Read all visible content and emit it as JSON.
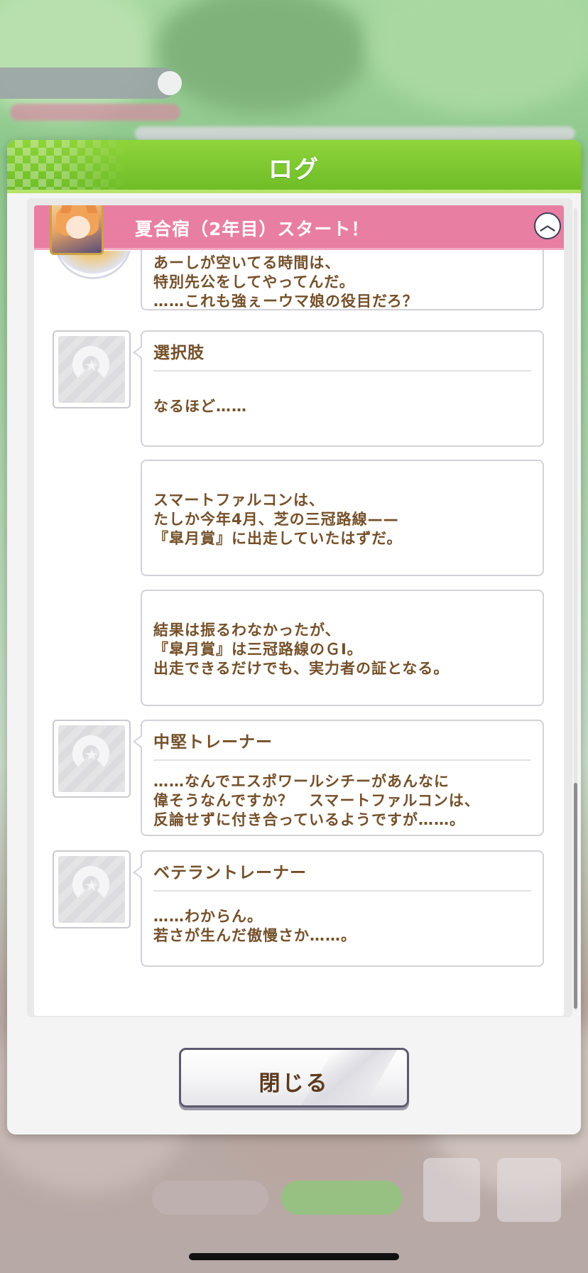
{
  "dialog": {
    "title": "ログ",
    "close_label": "閉じる"
  },
  "section": {
    "title": "夏合宿（2年目）スタート！",
    "collapse_icon": "chevron-up-icon"
  },
  "entries": [
    {
      "speaker": "",
      "text": "あーしが空いてる時間は、\n特別先公をしてやってんだ。\n……これも強ぇーウマ娘の役目だろ？"
    },
    {
      "speaker": "選択肢",
      "text": "なるほど……"
    },
    {
      "speaker": "",
      "text": "スマートファルコンは、\nたしか今年4月、芝の三冠路線——\n『皐月賞』に出走していたはずだ。"
    },
    {
      "speaker": "",
      "text": "結果は振るわなかったが、\n『皐月賞』は三冠路線のＧⅠ。\n出走できるだけでも、実力者の証となる。"
    },
    {
      "speaker": "中堅トレーナー",
      "text": "……なんでエスポワールシチーがあんなに\n偉そうなんですか？　スマートファルコンは、\n反論せずに付き合っているようですが……。"
    },
    {
      "speaker": "ベテラントレーナー",
      "text": "……わからん。\n若さが生んだ傲慢さか……。"
    }
  ],
  "colors": {
    "header_green": "#7cc832",
    "section_pink": "#e87fa3",
    "text_brown": "#74502a"
  }
}
